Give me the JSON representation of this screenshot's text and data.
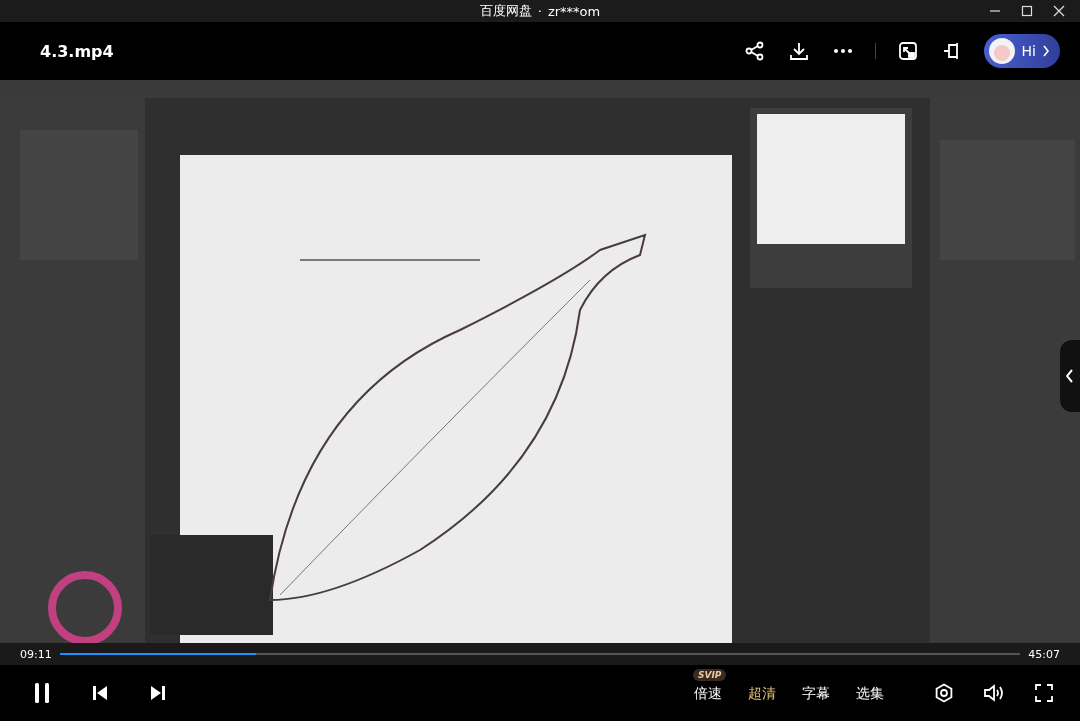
{
  "window": {
    "title": "百度网盘",
    "separator": "·",
    "account": "zr***om"
  },
  "header": {
    "file_name": "4.3.mp4",
    "assistant_label": "Hi"
  },
  "progress": {
    "elapsed": "09:11",
    "duration": "45:07",
    "level": 0.204
  },
  "controls": {
    "playing": true,
    "options": [
      {
        "label": "倍速",
        "badge": "SVIP",
        "selected": false
      },
      {
        "label": "超清",
        "selected": true
      },
      {
        "label": "字幕",
        "selected": false
      },
      {
        "label": "选集",
        "selected": false
      }
    ]
  }
}
